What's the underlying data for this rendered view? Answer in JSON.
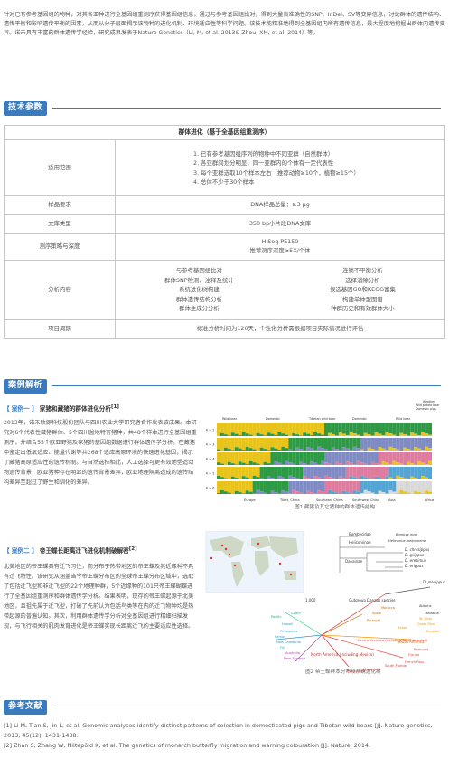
{
  "intro_text": "针对已有参考基因组的物种，对其各亚种进行全基因组重测序获得基因组信息，通过与参考基因组比对，得到大量高准确性的SNP、InDel、SV等变异信息，讨论群体的遗传结构、遗传平衡和影响遗传平衡的因素，从而从分子层面揭示该物种的进化机制、环境适应性等科学问题。该技术能精准地得到全基因组内所有遗传信息，最大程度地挖掘出群体内遗传变异。诺禾具有丰富的群体遗传学经验，研究成果发表于Nature Genetics（Li, M, et al. 2013& Zhou, XM, et al. 2014）等。",
  "sections": {
    "tech": "技术参数",
    "cases": "案例解析",
    "refs": "参考文献"
  },
  "table": {
    "header": "群体进化（基于全基因组重测序）",
    "rows": {
      "scope_label": "适用范围",
      "scope_items": [
        "1. 已有参考基因组序列的物种中不同亚群（自然群体）",
        "2. 各亚群间划分明显，同一亚群内的个体有一定代表性",
        "3. 每个亚群选取10个样本左右（推荐动物≥10个，植物≥15个）",
        "4. 总体不少于30个样本"
      ],
      "sample_label": "样品要求",
      "sample_value": "DNA样品总量：≥3 μg",
      "lib_label": "文库类型",
      "lib_value": "350 bp小片段DNA文库",
      "seq_label": "测序策略与深度",
      "seq_value_1": "HiSeq PE150",
      "seq_value_2": "推荐测序深度≥5X/个体",
      "analysis_label": "分析内容",
      "analysis_left": [
        "与参考基因组比对",
        "群体SNP检测、注释及统计",
        "系统进化树构建",
        "群体遗传结构分析",
        "群体主成分分析"
      ],
      "analysis_right": [
        "连锁不平衡分析",
        "选择消除分析",
        "候选基因GO和KEGG富集",
        "构建单体型图谱",
        "种群历史和有效群体大小"
      ],
      "cycle_label": "项目周期",
      "cycle_value": "标准分析时间为120天，个性化分析需根据项目实际情况进行评估"
    }
  },
  "case1": {
    "label": "【 案例一 】",
    "title": "家猪和藏猪的群体进化分析",
    "sup": "[1]",
    "text": "2013年，诺禾致源科技股份团队与四川农业大学研究者合作发表该成果。本研究对6个代表性藏猪群体、5个四川盆地特有猪种，共48个样本进行全基因组重测序，并结合55个欧亚野猪及家猪的基因组数据进行群体遗传学分析。在藏猪中鉴定出低氧适应、能量代谢等共268个适应高原环境的快速进化基因，揭示了藏猪高原适应性的遗传机制。与自然选择相比，人工选择可更有效地塑造动物遗传背景，欧亚猪种存在明显的遗传背景差异，欧亚地理隔离造成的遗传结构差异至超过了野生和驯化的差异。",
    "caption": "图1  藏猪及其它猪种的群体遗传结构",
    "legend": [
      "Weathes",
      "Wild potato boar",
      "Domestic pigs"
    ],
    "groups_top": [
      "Wild boar",
      "Domestic",
      "Tibetan wild boar",
      "Domestic",
      "Wild boar"
    ],
    "groups_bottom": [
      "Europe",
      "Tibet, China",
      "Southeast China",
      "Southwest China",
      "Asia",
      "Africa"
    ],
    "k_labels": [
      "K = 2",
      "K = 3",
      "K = 4",
      "K = 5",
      "K = 6"
    ]
  },
  "case2": {
    "label": "【 案例二 】",
    "title": "帝王蝶长距离迁飞进化机制破解密",
    "sup": "[2]",
    "text": "北美地区的帝王蝶具有迁飞习性，而分布于热带地区的帝王蝶及其近缘种不具有迁飞特性。该研究从涵盖当今帝王蝶分布区的全球帝王蝶分布区域中，选取了包括迁飞型和非迁飞型的22个地理种群，5个近缘种的101只帝王蝶蝴蝶进行了全基因组重测序和群体遗传学分析。结果表明，现存的帝王蝶起源于北美地区，且祖先属于迁飞型，打破了先前认为包括鸟类等在内的迁飞物种均是热带起源的普遍认知。其次，利用群体遗传学分析对全基因组进行精细扫描发现，与飞行相关的肌肉发育进化是帝王蝶实现长距离迁飞的主要适应性选择。",
    "caption": "图2  帝王蝶样本分布及系统进化树",
    "tree_labels": [
      "Bombycidae",
      "Bombyx mori",
      "Heliconiinae",
      "Heliconius melpomene",
      "Danainae",
      "D. chrysippus",
      "D. gilippus",
      "D. eresimus",
      "D. erippus",
      "D. plexippus",
      "Outgroup Danaus species",
      "North America (including Mexico)",
      "South America",
      "Central America (including South America)",
      "Pacific",
      "Atlantic",
      "Hawaii",
      "Portugal",
      "Spain",
      "Morocco",
      "Philippines",
      "Samoa",
      "New Caledonia",
      "Fiji",
      "Australia",
      "New Zealand",
      "Bermuda",
      "Florida",
      "French Pass",
      "Ecuador",
      "Costa Rica",
      "Belize",
      "South Florida",
      "Hispaniola",
      "Puerto Rico",
      "Guam",
      "Tanzania",
      "St. Kitts",
      "1,000"
    ]
  },
  "references": [
    "[1]  Li M, Tian S, Jin L, et al. Genomic analyses identify distinct patterns of selection in domesticated pigs and Tibetan wild boars [J]. Nature genetics, 2013, 45(12): 1431-1438.",
    "[2]  Zhan S, Zhang W, Niitepõld K, et al. The genetics of monarch butterfly migration and warning colouration [J]. Nature, 2014."
  ],
  "colors": {
    "accent": "#3a7bbd",
    "chart_colors": [
      "#e8c31b",
      "#2f9a45",
      "#7e8bc4",
      "#e07b9f",
      "#52a6d6",
      "#d9d9d9"
    ]
  }
}
